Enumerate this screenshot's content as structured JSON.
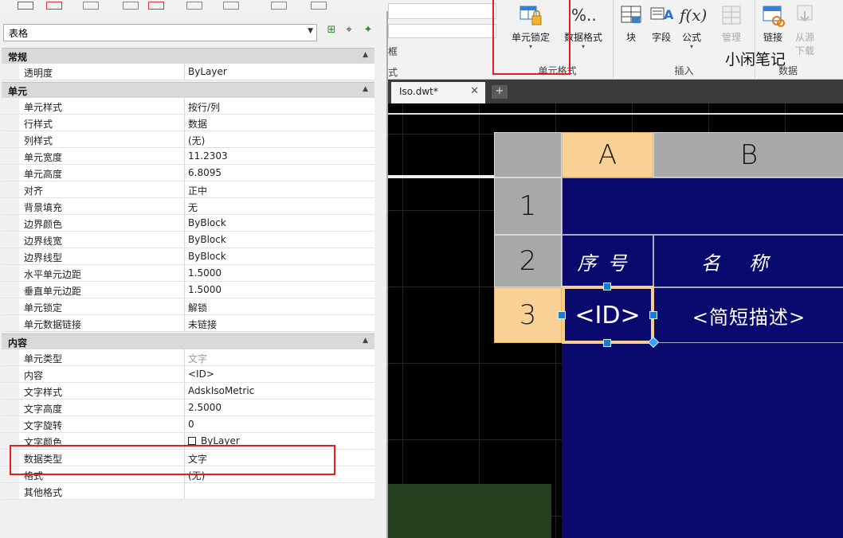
{
  "ribbon": {
    "groups": [
      {
        "label": "单元格式"
      },
      {
        "label": "插入"
      },
      {
        "label": "数据"
      }
    ],
    "buttons": [
      {
        "label": "单元锁定",
        "icon": "cell-lock-icon"
      },
      {
        "label": "数据格式",
        "icon": "data-format-icon",
        "glyph": "%.."
      },
      {
        "label": "块",
        "icon": "block-icon"
      },
      {
        "label": "字段",
        "icon": "field-icon"
      },
      {
        "label": "公式",
        "icon": "formula-icon",
        "glyph": "f(x)"
      },
      {
        "label": "管理",
        "icon": "manage-icon"
      },
      {
        "label": "链接",
        "icon": "link-icon"
      },
      {
        "label": "从源",
        "icon": "download-from-source-icon"
      }
    ],
    "sub_labels": {
      "cut_single": "单",
      "download": "下载",
      "frame": "框",
      "style": "式"
    }
  },
  "watermark": "小闲笔记",
  "doc_tabs": [
    {
      "label": "Iso.dwt*",
      "close": "✕"
    }
  ],
  "add_tab_label": "+",
  "palette": {
    "selector_value": "表格",
    "sections": [
      {
        "title": "常规",
        "rows": [
          {
            "name": "透明度",
            "value": "ByLayer"
          }
        ]
      },
      {
        "title": "单元",
        "rows": [
          {
            "name": "单元样式",
            "value": "按行/列"
          },
          {
            "name": "行样式",
            "value": "数据"
          },
          {
            "name": "列样式",
            "value": "(无)"
          },
          {
            "name": "单元宽度",
            "value": "11.2303"
          },
          {
            "name": "单元高度",
            "value": "6.8095"
          },
          {
            "name": "对齐",
            "value": "正中"
          },
          {
            "name": "背景填充",
            "value": "无"
          },
          {
            "name": "边界颜色",
            "value": "ByBlock"
          },
          {
            "name": "边界线宽",
            "value": "ByBlock"
          },
          {
            "name": "边界线型",
            "value": "ByBlock"
          },
          {
            "name": "水平单元边距",
            "value": "1.5000"
          },
          {
            "name": "垂直单元边距",
            "value": "1.5000"
          },
          {
            "name": "单元锁定",
            "value": "解锁"
          },
          {
            "name": "单元数据链接",
            "value": "未链接"
          }
        ]
      },
      {
        "title": "内容",
        "rows": [
          {
            "name": "单元类型",
            "value": "文字"
          },
          {
            "name": "内容",
            "value": "<ID>"
          },
          {
            "name": "文字样式",
            "value": "AdskIsoMetric"
          },
          {
            "name": "文字高度",
            "value": "2.5000"
          },
          {
            "name": "文字旋转",
            "value": "0"
          },
          {
            "name": "文字颜色",
            "value": "ByLayer"
          },
          {
            "name": "数据类型",
            "value": "文字"
          },
          {
            "name": "格式",
            "value": "(无)"
          },
          {
            "name": "其他格式",
            "value": ""
          }
        ]
      }
    ]
  },
  "table": {
    "col_headers": [
      "A",
      "B"
    ],
    "row_headers": [
      "1",
      "2",
      "3"
    ],
    "row2": [
      "序号",
      "名称"
    ],
    "row3": [
      "<ID>",
      "<简短描述>"
    ]
  },
  "colors": {
    "highlight": "#e02020",
    "selected_header": "#f9d194",
    "table_fill": "#0a0a6e"
  }
}
